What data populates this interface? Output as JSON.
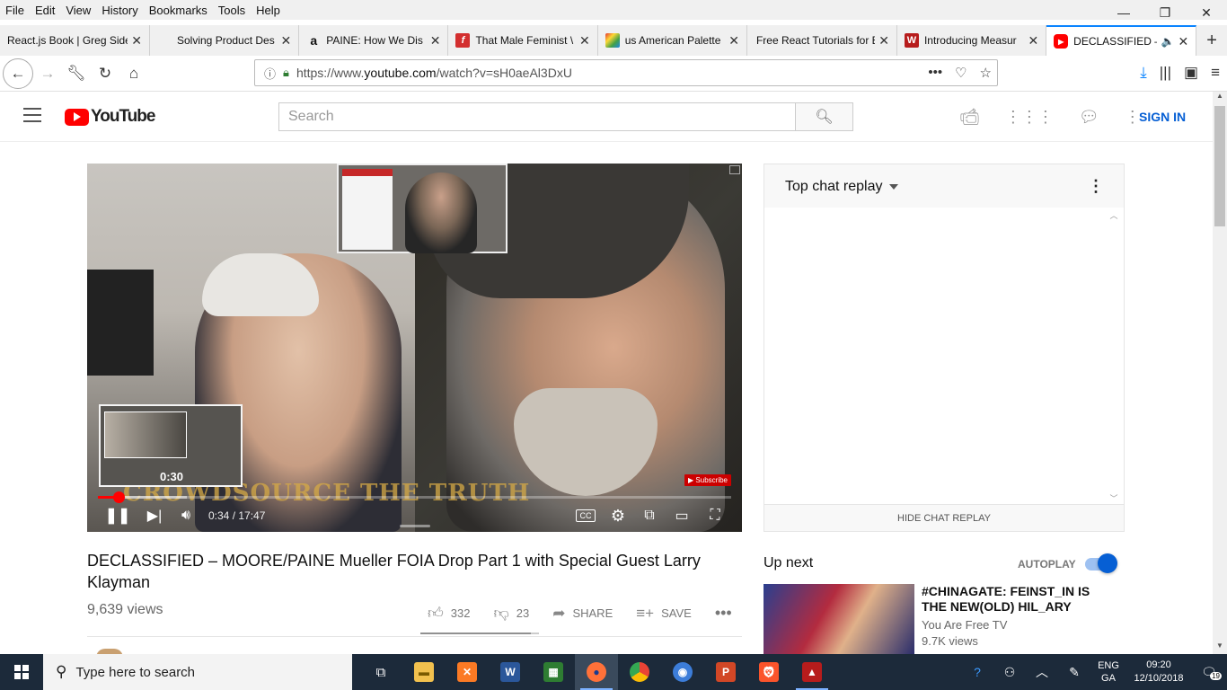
{
  "menubar": {
    "items": [
      "File",
      "Edit",
      "View",
      "History",
      "Bookmarks",
      "Tools",
      "Help"
    ]
  },
  "window_controls": {
    "minimize": "—",
    "restore": "❐",
    "close": "✕"
  },
  "tabs": [
    {
      "title": "React.js Book | Greg Side",
      "favicon": "none"
    },
    {
      "title": "Solving Product Des",
      "favicon": "none"
    },
    {
      "title": "PAINE: How We Dis",
      "favicon": "amazon-icon"
    },
    {
      "title": "That Male Feminist \\",
      "favicon": "f-icon"
    },
    {
      "title": "us American Palette",
      "favicon": "palette-icon"
    },
    {
      "title": "Free React Tutorials for E",
      "favicon": "none"
    },
    {
      "title": "Introducing Measur",
      "favicon": "w-icon"
    },
    {
      "title": "DECLASSIFIED – I",
      "favicon": "youtube-icon",
      "active": true
    }
  ],
  "navbar": {
    "url_prefix": "https://www.",
    "url_host": "youtube.com",
    "url_path": "/watch?v=sH0aeAl3DxU"
  },
  "youtube": {
    "logo_text": "YouTube",
    "search_placeholder": "Search",
    "sign_in": "SIGN IN"
  },
  "video": {
    "watermark": "CROWDSOURCE THE TRUTH",
    "subscribe_badge": "Subscribe",
    "preview_time": "0:30",
    "current_time": "0:34",
    "duration": "17:47",
    "time_display": "0:34 / 17:47",
    "progress_played": 0.032,
    "progress_loaded": 0.14,
    "cc_label": "CC"
  },
  "chat": {
    "title": "Top chat replay",
    "hide_label": "HIDE CHAT REPLAY"
  },
  "meta": {
    "title": "DECLASSIFIED – MOORE/PAINE Mueller FOIA Drop Part 1 with Special Guest Larry Klayman",
    "views": "9,639 views",
    "likes": "332",
    "dislikes": "23",
    "share": "SHARE",
    "save": "SAVE",
    "like_ratio": 0.935
  },
  "upnext": {
    "heading": "Up next",
    "autoplay": "AUTOPLAY",
    "autoplay_on": true,
    "items": [
      {
        "title": "#CHINAGATE: FEINST_IN IS THE NEW(OLD) HIL_ARY",
        "channel": "You Are Free TV",
        "views": "9.7K views"
      }
    ]
  },
  "taskbar": {
    "search_placeholder": "Type here to search",
    "lang_top": "ENG",
    "lang_bottom": "GA",
    "time": "09:20",
    "date": "12/10/2018",
    "notification_count": "19",
    "accent": "#1c2a3a"
  }
}
